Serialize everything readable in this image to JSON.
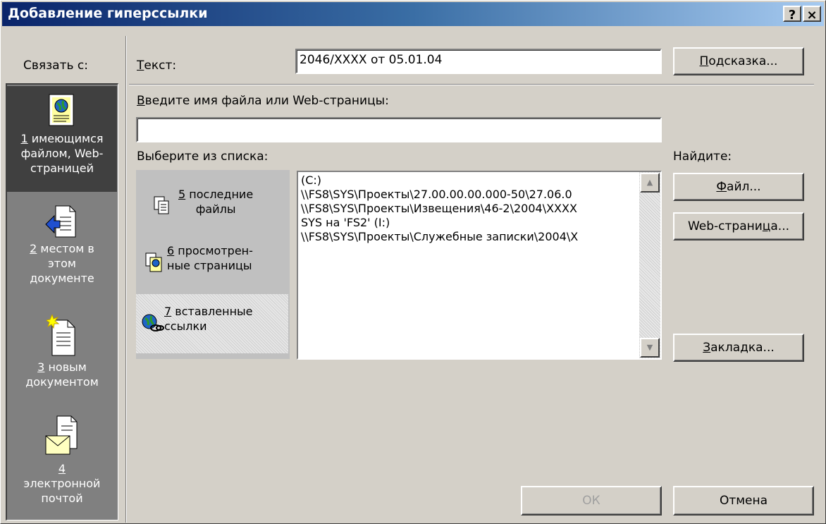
{
  "window": {
    "title": "Добавление гиперссылки",
    "help_button": "?",
    "close_button": "×"
  },
  "link_with": {
    "label": "Связать с:",
    "items": [
      {
        "key": "1",
        "rest": " имеющимся файлом, Web-страницей",
        "line1_rest": " имеющимся",
        "line2": "файлом, Web-",
        "line3": "страницей",
        "icon": "web-page-icon",
        "selected": true
      },
      {
        "key": "2",
        "line1_rest": " местом в",
        "line2": "этом",
        "line3": "документе",
        "icon": "place-in-document-icon"
      },
      {
        "key": "3",
        "line1_rest": " новым",
        "line2": "документом",
        "icon": "new-document-icon"
      },
      {
        "key": "4",
        "line1_rest": "",
        "line2": "электронной",
        "line3": "почтой",
        "icon": "email-icon"
      }
    ]
  },
  "text_field": {
    "label_key": "Т",
    "label_rest": "екст:",
    "value": "2046/XXXX от 05.01.04"
  },
  "hint_button": {
    "key": "П",
    "rest": "одсказка..."
  },
  "address": {
    "label_key": "В",
    "label_rest": "ведите имя файла или Web-страницы:",
    "value": ""
  },
  "choose_label": "Выберите из списка:",
  "find_label": "Найдите:",
  "categories": [
    {
      "key": "5",
      "line1_rest": " последние",
      "line2": "файлы",
      "icon": "recent-files-icon"
    },
    {
      "key": "6",
      "line1_rest": " просмотрен-",
      "line2": "ные страницы",
      "icon": "browsed-pages-icon"
    },
    {
      "key": "7",
      "line1_rest": " вставленные",
      "line2": "ссылки",
      "icon": "inserted-links-icon",
      "selected": true
    }
  ],
  "list_rows": [
    " (C:)",
    "\\\\FS8\\SYS\\Проекты\\27.00.00.00.000-50\\27.06.0",
    "\\\\FS8\\SYS\\Проекты\\Извещения\\46-2\\2004\\XXXX",
    "SYS на 'FS2' (I:)",
    "\\\\FS8\\SYS\\Проекты\\Служебные записки\\2004\\X"
  ],
  "buttons": {
    "file": {
      "key": "Ф",
      "rest": "айл..."
    },
    "web_page": {
      "pre": "Web-страни",
      "key": "ц",
      "rest": "а..."
    },
    "bookmark": {
      "key": "З",
      "rest": "акладка..."
    },
    "ok": "ОК",
    "cancel": "Отмена"
  }
}
